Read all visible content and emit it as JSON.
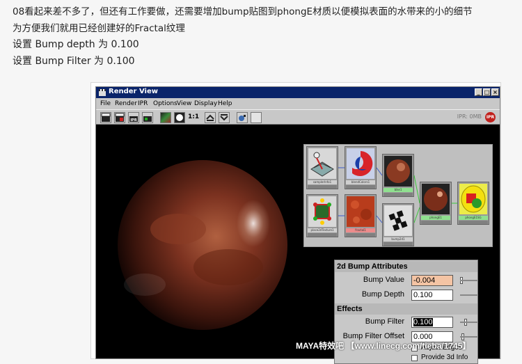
{
  "intro": {
    "line1": "08看起来差不多了，但还有工作要做，还需要增加bump贴图到phongE材质以便模拟表面的水带来的小的细节",
    "line2": "为方便我们就用已经创建好的Fractal纹理",
    "line3": "设置 Bump depth 为 0.100",
    "line4": "设置 Bump Filter 为 0.100"
  },
  "window": {
    "title": "Render View",
    "minimize": "_",
    "maximize": "□",
    "close": "×"
  },
  "menu": [
    "File",
    "Render",
    "IPR",
    "Options",
    "View",
    "Display",
    "Help"
  ],
  "toolbar": {
    "ratio": "1:1",
    "ipr_status": "IPR: 0MB",
    "ipr_button": "IPR"
  },
  "hypergraph": {
    "nodes": [
      {
        "label": "samplerInfo1",
        "icon": "sampler-info-icon",
        "color": "#9a9a9a"
      },
      {
        "label": "blendColors1",
        "icon": "blend-colors-icon",
        "color": "#9a9a9a"
      },
      {
        "label": "bike1",
        "icon": "texture-swatch-icon",
        "color": "#8fe08f"
      },
      {
        "label": "place2dTexture1",
        "icon": "place2d-icon",
        "color": "#9a9a9a"
      },
      {
        "label": "fractal1",
        "icon": "fractal-swatch-icon",
        "color": "#ec8c8c"
      },
      {
        "label": "bump2d1",
        "icon": "bump2d-icon",
        "color": "#9a9a9a"
      },
      {
        "label": "phongE1",
        "icon": "phong-sphere-icon",
        "color": "#8fe08f"
      },
      {
        "label": "phongE1SG",
        "icon": "shading-group-icon",
        "color": "#8fe08f"
      }
    ]
  },
  "attributes": {
    "section_title": "2d Bump Attributes",
    "bump_value_label": "Bump Value",
    "bump_value": "-0.004",
    "bump_depth_label": "Bump Depth",
    "bump_depth": "0.100",
    "effects_title": "Effects",
    "bump_filter_label": "Bump Filter",
    "bump_filter": "0.100",
    "bump_filter_offset_label": "Bump Filter Offset",
    "bump_filter_offset": "0.000",
    "adjust_edges": "Adjust Edges",
    "provide_3d_info": "Provide 3d Info"
  },
  "watermark": "MAYA特效吧 【www.linecg.com/tieba/1745】",
  "colors": {
    "titlebar": "#0a246a",
    "panel": "#c8c8c8",
    "bump_value_field": "#f4c4a4"
  }
}
